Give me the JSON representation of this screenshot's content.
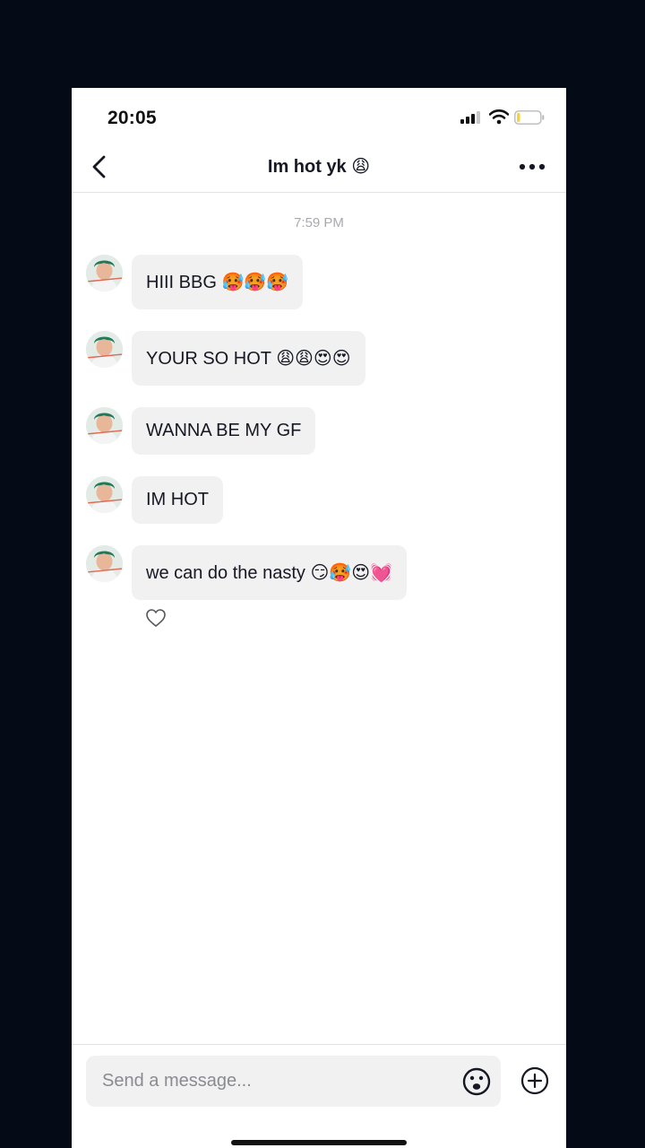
{
  "status_bar": {
    "time": "20:05"
  },
  "header": {
    "title": "Im hot yk 😩"
  },
  "conversation": {
    "timestamp": "7:59 PM",
    "messages": [
      {
        "text": "HIII BBG 🥵🥵🥵"
      },
      {
        "text": "YOUR SO HOT 😩😩😍😍"
      },
      {
        "text": "WANNA BE MY GF"
      },
      {
        "text": "IM HOT"
      },
      {
        "text": "we can do the nasty 😏🥵😍💓"
      }
    ]
  },
  "composer": {
    "placeholder": "Send a message..."
  },
  "colors": {
    "backdrop": "#050b16",
    "bubble": "#f1f1f2",
    "text": "#161823",
    "timestamp": "#a9a9ae",
    "battery_level": "#f5d33b"
  },
  "icons": [
    "back-chevron-icon",
    "more-dots-icon",
    "heart-outline-icon",
    "emoji-face-icon",
    "plus-circle-icon",
    "signal-icon",
    "wifi-icon",
    "battery-icon"
  ]
}
